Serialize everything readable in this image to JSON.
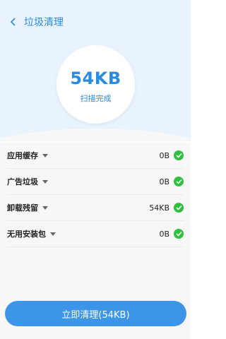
{
  "header": {
    "back_icon": "chevron-left-icon",
    "title": "垃圾清理"
  },
  "scan": {
    "size": "54KB",
    "status": "扫描完成"
  },
  "items": [
    {
      "label": "应用缓存",
      "size": "0B",
      "checked": true
    },
    {
      "label": "广告垃圾",
      "size": "0B",
      "checked": true
    },
    {
      "label": "卸载残留",
      "size": "54KB",
      "checked": true
    },
    {
      "label": "无用安装包",
      "size": "0B",
      "checked": true
    }
  ],
  "action": {
    "clean_label": "立即清理(54KB)"
  },
  "colors": {
    "accent": "#2a8be0",
    "button": "#3c95e6",
    "check": "#2fbf3f",
    "header_bg": "#e9f3fd"
  }
}
